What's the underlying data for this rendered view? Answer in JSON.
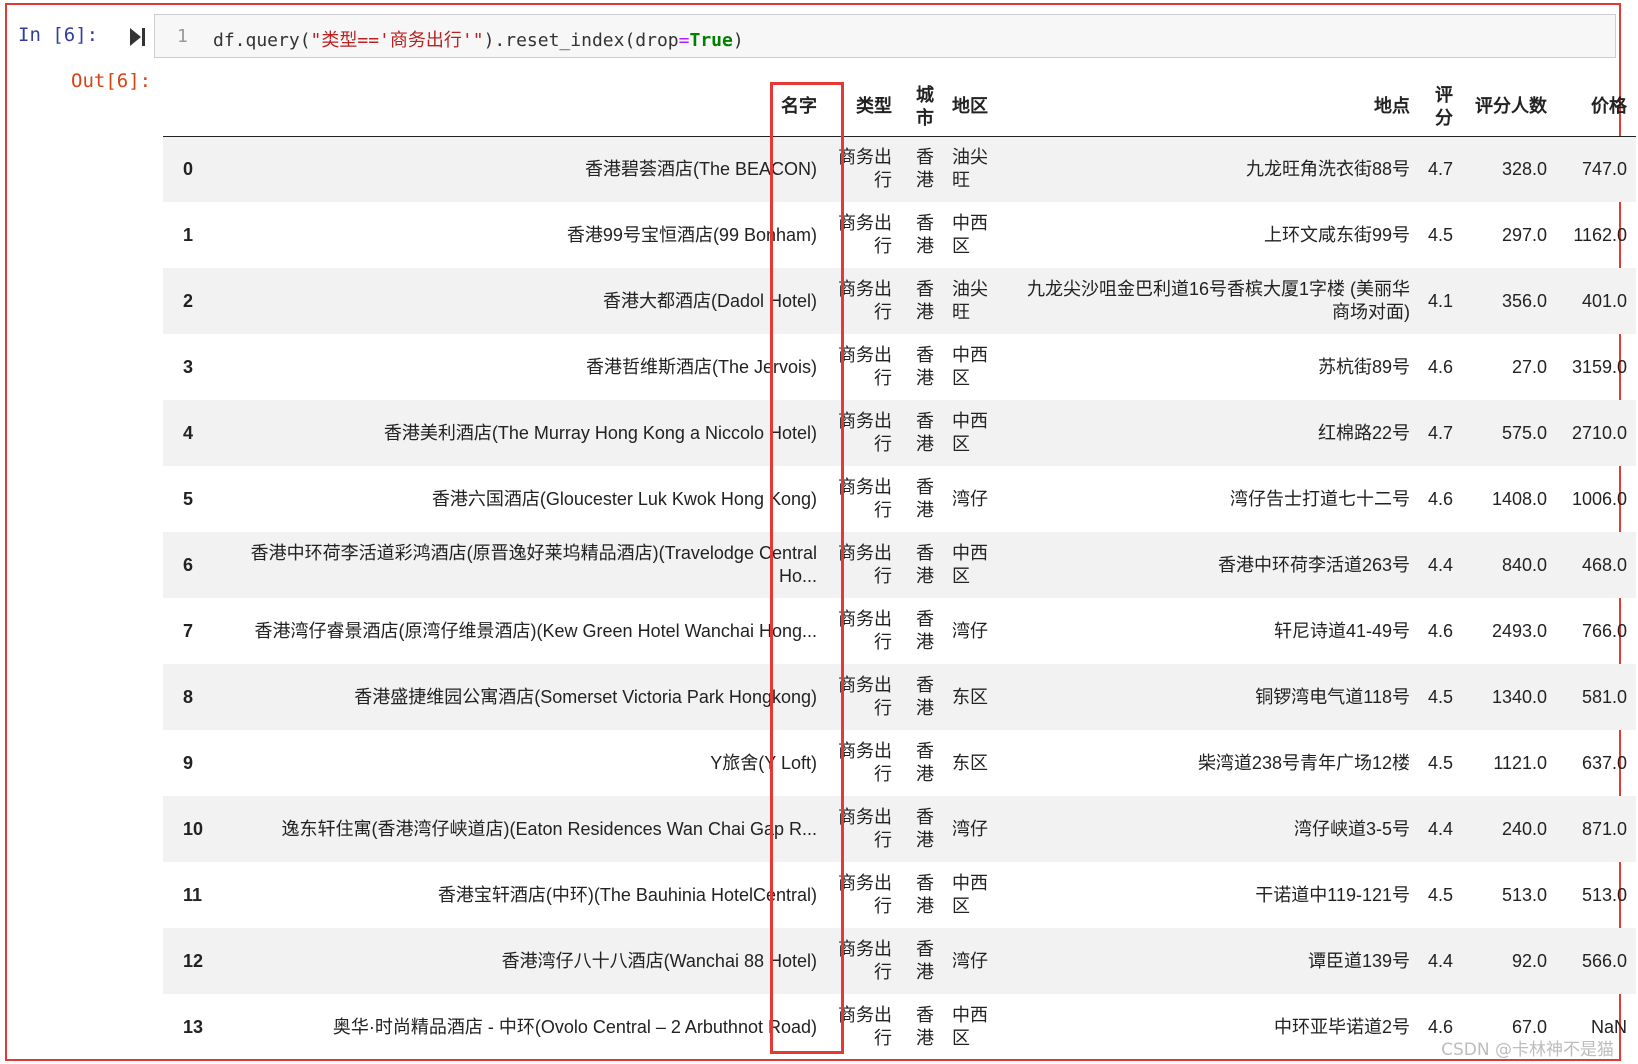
{
  "prompts": {
    "in": "In  [6]:",
    "out": "Out[6]:"
  },
  "code": {
    "line_number": "1",
    "prefix": "df.query(",
    "query_string": "\"类型=='商务出行'\"",
    "suffix": ").reset_index(drop",
    "equals": "=",
    "kw_true": "True",
    "close": ")"
  },
  "table": {
    "headers": [
      "",
      "名字",
      "类型",
      "城市",
      "地区",
      "地点",
      "评分",
      "评分人数",
      "价格"
    ],
    "rows": [
      [
        "0",
        "香港碧荟酒店(The BEACON)",
        "商务出行",
        "香港",
        "油尖旺",
        "九龙旺角洗衣街88号",
        "4.7",
        "328.0",
        "747.0"
      ],
      [
        "1",
        "香港99号宝恒酒店(99 Bonham)",
        "商务出行",
        "香港",
        "中西区",
        "上环文咸东街99号",
        "4.5",
        "297.0",
        "1162.0"
      ],
      [
        "2",
        "香港大都酒店(Dadol Hotel)",
        "商务出行",
        "香港",
        "油尖旺",
        "九龙尖沙咀金巴利道16号香槟大厦1字楼 (美丽华商场对面)",
        "4.1",
        "356.0",
        "401.0"
      ],
      [
        "3",
        "香港哲维斯酒店(The Jervois)",
        "商务出行",
        "香港",
        "中西区",
        "苏杭街89号",
        "4.6",
        "27.0",
        "3159.0"
      ],
      [
        "4",
        "香港美利酒店(The Murray Hong Kong a Niccolo Hotel)",
        "商务出行",
        "香港",
        "中西区",
        "红棉路22号",
        "4.7",
        "575.0",
        "2710.0"
      ],
      [
        "5",
        "香港六国酒店(Gloucester Luk Kwok Hong Kong)",
        "商务出行",
        "香港",
        "湾仔",
        "湾仔告士打道七十二号",
        "4.6",
        "1408.0",
        "1006.0"
      ],
      [
        "6",
        "香港中环荷李活道彩鸿酒店(原晋逸好莱坞精品酒店)(Travelodge Central Ho...",
        "商务出行",
        "香港",
        "中西区",
        "香港中环荷李活道263号",
        "4.4",
        "840.0",
        "468.0"
      ],
      [
        "7",
        "香港湾仔睿景酒店(原湾仔维景酒店)(Kew Green Hotel Wanchai Hong...",
        "商务出行",
        "香港",
        "湾仔",
        "轩尼诗道41-49号",
        "4.6",
        "2493.0",
        "766.0"
      ],
      [
        "8",
        "香港盛捷维园公寓酒店(Somerset Victoria Park Hongkong)",
        "商务出行",
        "香港",
        "东区",
        "铜锣湾电气道118号",
        "4.5",
        "1340.0",
        "581.0"
      ],
      [
        "9",
        "Y旅舍(Y Loft)",
        "商务出行",
        "香港",
        "东区",
        "柴湾道238号青年广场12楼",
        "4.5",
        "1121.0",
        "637.0"
      ],
      [
        "10",
        "逸东轩住寓(香港湾仔峡道店)(Eaton Residences Wan Chai Gap R...",
        "商务出行",
        "香港",
        "湾仔",
        "湾仔峡道3-5号",
        "4.4",
        "240.0",
        "871.0"
      ],
      [
        "11",
        "香港宝轩酒店(中环)(The Bauhinia HotelCentral)",
        "商务出行",
        "香港",
        "中西区",
        "干诺道中119-121号",
        "4.5",
        "513.0",
        "513.0"
      ],
      [
        "12",
        "香港湾仔八十八酒店(Wanchai 88 Hotel)",
        "商务出行",
        "香港",
        "湾仔",
        "谭臣道139号",
        "4.4",
        "92.0",
        "566.0"
      ],
      [
        "13",
        "奥华·时尚精品酒店 - 中环(Ovolo Central – 2 Arbuthnot Road)",
        "商务出行",
        "香港",
        "中西区",
        "中环亚毕诺道2号",
        "4.6",
        "67.0",
        "NaN"
      ]
    ]
  },
  "watermark": "CSDN @卡林神不是猫",
  "colors": {
    "highlight": "#e53935",
    "prompt_in": "#303f9f",
    "prompt_out": "#d84315"
  },
  "icons": {
    "run": "run-cell-icon"
  }
}
